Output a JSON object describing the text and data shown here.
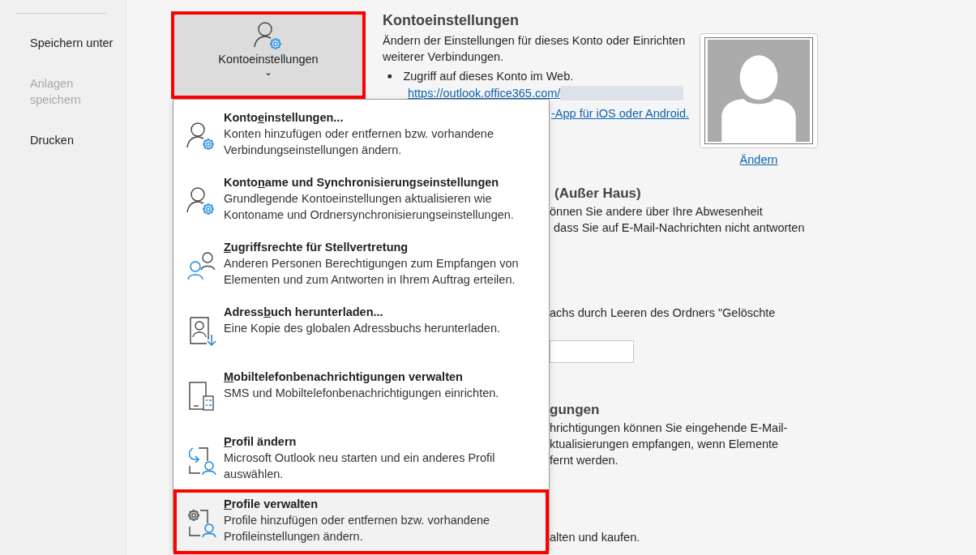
{
  "nav": {
    "items": [
      {
        "label": "Speichern unter",
        "disabled": false
      },
      {
        "label": "Anlagen speichern",
        "disabled": true
      },
      {
        "label": "Drucken",
        "disabled": false
      }
    ]
  },
  "account_button": {
    "label": "Kontoeinstellungen",
    "caret": "⌄",
    "highlighted": true
  },
  "account_info": {
    "heading": "Kontoeinstellungen",
    "description": "Ändern der Einstellungen für dieses Konto oder Einrichten weiterer Verbindungen.",
    "bullet": "■",
    "bullet_text": "Zugriff auf dieses Konto im Web.",
    "web_link": "https://outlook.office365.com/",
    "app_link_fragment": "-App für iOS oder Android."
  },
  "avatar": {
    "change_link": "Ändern"
  },
  "out_of_office": {
    "heading_fragment": "(Außer Haus)",
    "lines": [
      "önnen Sie andere über Ihre Abwesenheit",
      "dass Sie auf E-Mail-Nachrichten nicht antworten"
    ]
  },
  "cleanup": {
    "line": "achs durch Leeren des Ordners \"Gelöschte"
  },
  "rules": {
    "heading_fragment": "gungen",
    "lines": [
      "hrichtigungen können Sie eingehende E-Mail-",
      "ktualisierungen empfangen, wenn Elemente",
      "fernt werden."
    ]
  },
  "addins": {
    "line": "alten und kaufen."
  },
  "menu": {
    "items": [
      {
        "kind": "account",
        "title": {
          "before": "Konto",
          "key": "e",
          "after": "instellungen..."
        },
        "description": "Konten hinzufügen oder entfernen bzw. vorhandene Verbindungseinstellungen ändern.",
        "highlighted": false
      },
      {
        "kind": "account",
        "title": {
          "before": "Konto",
          "key": "n",
          "after": "ame und Synchronisierungseinstellungen"
        },
        "description": "Grundlegende Kontoeinstellungen aktualisieren wie Kontoname und Ordnersynchronisierungseinstellungen.",
        "highlighted": false
      },
      {
        "kind": "delegate",
        "title": {
          "key": "Z",
          "after": "ugriffsrechte für Stellvertretung"
        },
        "description": "Anderen Personen Berechtigungen zum Empfangen von Elementen und zum Antworten in Ihrem Auftrag erteilen.",
        "highlighted": false
      },
      {
        "kind": "addressbook",
        "title": {
          "before": "Adress",
          "key": "b",
          "after": "uch herunterladen..."
        },
        "description": "Eine Kopie des globalen Adressbuchs herunterladen.",
        "highlighted": false
      },
      {
        "kind": "mobile",
        "title": {
          "key": "M",
          "after": "obiltelefonbenachrichtigungen verwalten"
        },
        "description": "SMS und Mobiltelefonbenachrichtigungen einrichten.",
        "highlighted": false
      },
      {
        "kind": "profile-switch",
        "title": {
          "key": "P",
          "after": "rofil ändern"
        },
        "description": "Microsoft Outlook neu starten und ein anderes Profil auswählen.",
        "highlighted": false
      },
      {
        "kind": "profile-manage",
        "title": {
          "key": "P",
          "after": "rofile verwalten"
        },
        "description": "Profile hinzufügen oder entfernen bzw. vorhandene Profileinstellungen ändern.",
        "highlighted": true
      }
    ]
  }
}
